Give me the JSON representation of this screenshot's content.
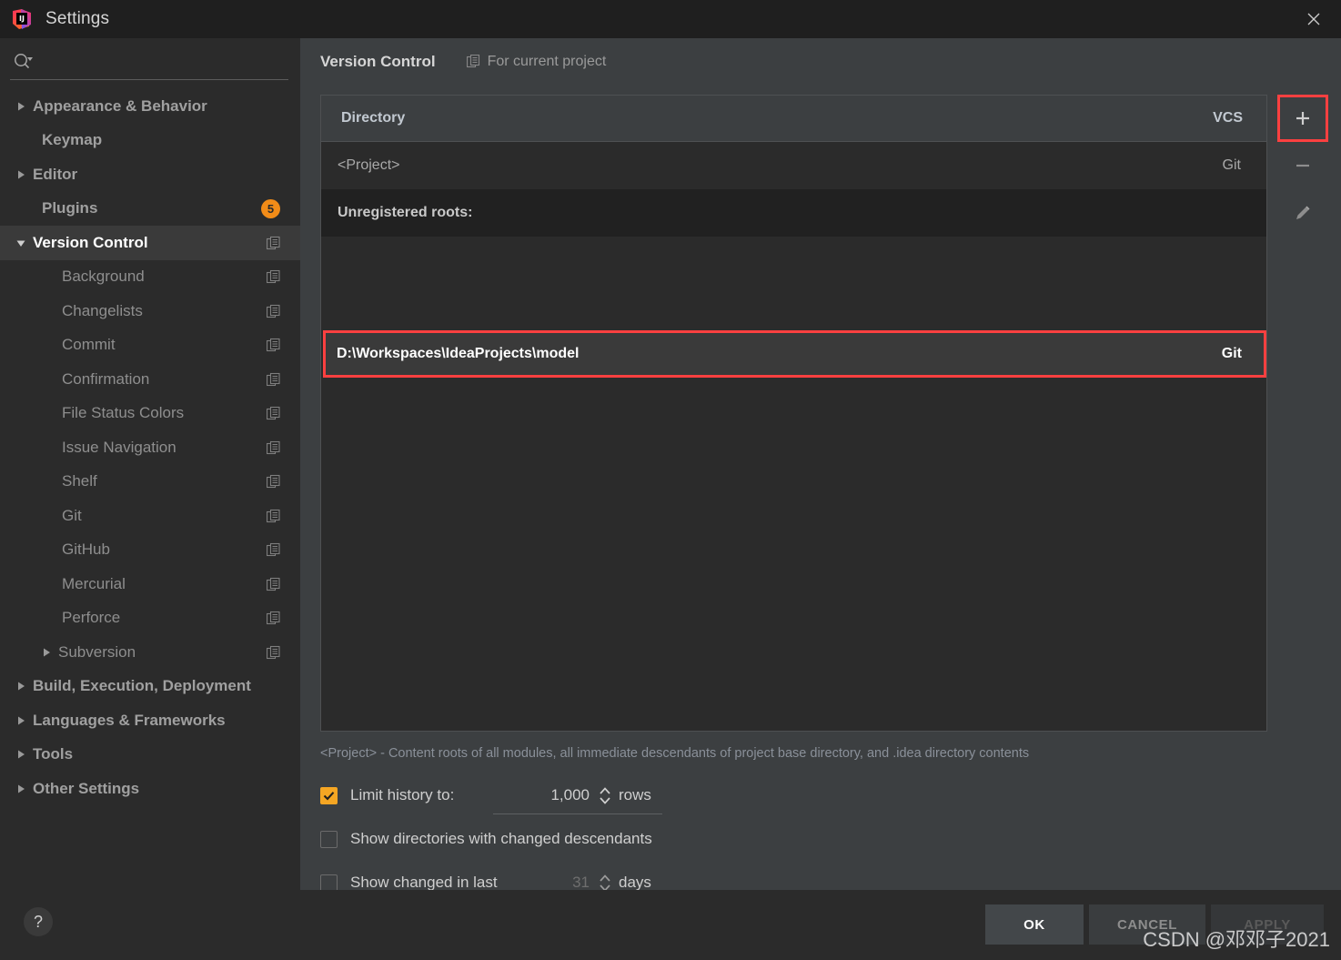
{
  "window": {
    "title": "Settings",
    "logo_icon": "intellij-idea-logo",
    "close_icon": "close-icon"
  },
  "sidebar": {
    "search": {
      "value": "",
      "placeholder": "",
      "icon": "search-icon"
    },
    "items": [
      {
        "label": "Appearance & Behavior",
        "level": 0,
        "arrow": "collapsed",
        "bold": true,
        "copy_icon": false
      },
      {
        "label": "Keymap",
        "level": 0,
        "arrow": "none",
        "bold": true,
        "copy_icon": false
      },
      {
        "label": "Editor",
        "level": 0,
        "arrow": "collapsed",
        "bold": true,
        "copy_icon": false
      },
      {
        "label": "Plugins",
        "level": 0,
        "arrow": "none",
        "bold": true,
        "badge": "5",
        "copy_icon": false
      },
      {
        "label": "Version Control",
        "level": 0,
        "arrow": "expanded",
        "bold": true,
        "selected": true,
        "copy_icon": true
      },
      {
        "label": "Background",
        "level": 1,
        "arrow": "none",
        "copy_icon": true
      },
      {
        "label": "Changelists",
        "level": 1,
        "arrow": "none",
        "copy_icon": true
      },
      {
        "label": "Commit",
        "level": 1,
        "arrow": "none",
        "copy_icon": true
      },
      {
        "label": "Confirmation",
        "level": 1,
        "arrow": "none",
        "copy_icon": true
      },
      {
        "label": "File Status Colors",
        "level": 1,
        "arrow": "none",
        "copy_icon": true
      },
      {
        "label": "Issue Navigation",
        "level": 1,
        "arrow": "none",
        "copy_icon": true
      },
      {
        "label": "Shelf",
        "level": 1,
        "arrow": "none",
        "copy_icon": true
      },
      {
        "label": "Git",
        "level": 1,
        "arrow": "none",
        "copy_icon": true
      },
      {
        "label": "GitHub",
        "level": 1,
        "arrow": "none",
        "copy_icon": true
      },
      {
        "label": "Mercurial",
        "level": 1,
        "arrow": "none",
        "copy_icon": true
      },
      {
        "label": "Perforce",
        "level": 1,
        "arrow": "none",
        "copy_icon": true
      },
      {
        "label": "Subversion",
        "level": 1,
        "arrow": "collapsed",
        "copy_icon": true
      },
      {
        "label": "Build, Execution, Deployment",
        "level": 0,
        "arrow": "collapsed",
        "bold": true,
        "copy_icon": false
      },
      {
        "label": "Languages & Frameworks",
        "level": 0,
        "arrow": "collapsed",
        "bold": true,
        "copy_icon": false
      },
      {
        "label": "Tools",
        "level": 0,
        "arrow": "collapsed",
        "bold": true,
        "copy_icon": false
      },
      {
        "label": "Other Settings",
        "level": 0,
        "arrow": "collapsed",
        "bold": true,
        "copy_icon": false
      }
    ]
  },
  "content": {
    "page_title": "Version Control",
    "scope_label": "For current project",
    "scope_icon": "copy-settings-icon",
    "table": {
      "columns": [
        "Directory",
        "VCS"
      ],
      "rows": [
        {
          "directory": "<Project>",
          "vcs": "Git",
          "type": "normal"
        },
        {
          "directory": "Unregistered roots:",
          "vcs": "",
          "type": "section"
        },
        {
          "directory": "D:\\Workspaces\\IdeaProjects\\model",
          "vcs": "Git",
          "type": "highlighted"
        }
      ]
    },
    "toolbar": {
      "add_label": "+",
      "remove_label": "−",
      "edit_label": "edit"
    },
    "hint": "<Project> - Content roots of all modules, all immediate descendants of project base directory, and .idea directory contents",
    "options": [
      {
        "id": "limit-history",
        "label": "Limit history to:",
        "checked": true,
        "value": "1,000",
        "suffix": "rows",
        "enabled": true
      },
      {
        "id": "show-directories",
        "label": "Show directories with changed descendants",
        "checked": false
      },
      {
        "id": "show-changed-in-last",
        "label": "Show changed in last",
        "checked": false,
        "value": "31",
        "suffix": "days",
        "enabled": false
      }
    ]
  },
  "footer": {
    "help_label": "?",
    "ok_label": "OK",
    "cancel_label": "CANCEL",
    "apply_label": "APPLY"
  },
  "watermark": "CSDN @邓邓子2021",
  "colors": {
    "accent_orange": "#f5a623",
    "highlight_red": "#fc4040",
    "panel_bg": "#3c3f41",
    "sidebar_bg": "#2b2b2b"
  }
}
